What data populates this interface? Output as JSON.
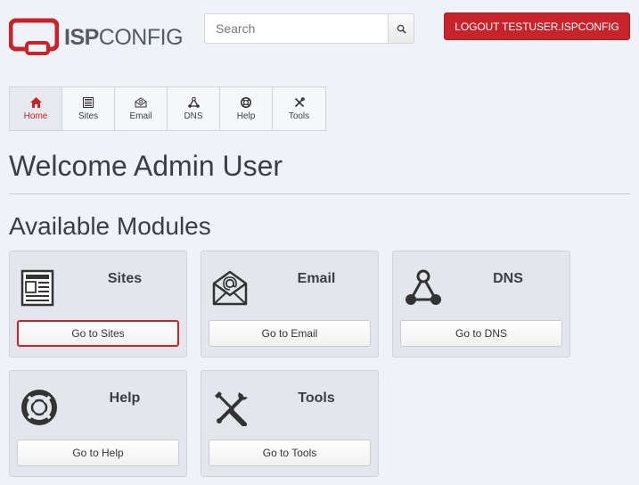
{
  "header": {
    "logo_bold": "ISP",
    "logo_light": "CONFIG",
    "search_placeholder": "Search",
    "logout_label": "LOGOUT TESTUSER.ISPCONFIG"
  },
  "nav": {
    "tabs": [
      {
        "label": "Home",
        "icon": "home-icon",
        "active": true
      },
      {
        "label": "Sites",
        "icon": "sites-icon"
      },
      {
        "label": "Email",
        "icon": "email-icon"
      },
      {
        "label": "DNS",
        "icon": "dns-icon"
      },
      {
        "label": "Help",
        "icon": "help-icon"
      },
      {
        "label": "Tools",
        "icon": "tools-icon"
      }
    ]
  },
  "main": {
    "welcome": "Welcome Admin User",
    "modules_heading": "Available Modules",
    "modules": [
      {
        "title": "Sites",
        "button": "Go to Sites",
        "icon": "sites-icon",
        "highlighted": true
      },
      {
        "title": "Email",
        "button": "Go to Email",
        "icon": "email-icon"
      },
      {
        "title": "DNS",
        "button": "Go to DNS",
        "icon": "dns-icon"
      },
      {
        "title": "Help",
        "button": "Go to Help",
        "icon": "help-icon"
      },
      {
        "title": "Tools",
        "button": "Go to Tools",
        "icon": "tools-icon"
      }
    ]
  },
  "colors": {
    "accent": "#c7232a",
    "background": "#eff3f8",
    "card": "#e3e6ea"
  }
}
